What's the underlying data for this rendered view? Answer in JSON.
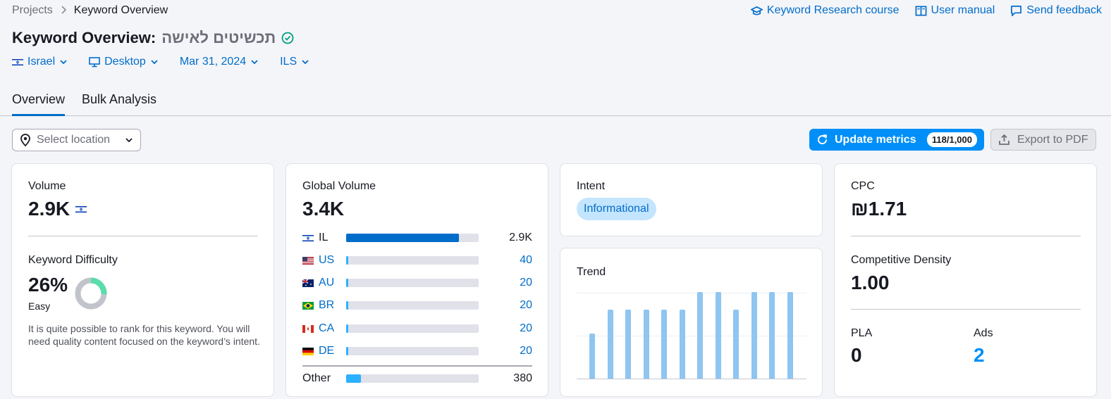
{
  "breadcrumb": {
    "root": "Projects",
    "current": "Keyword Overview"
  },
  "top_links": [
    {
      "label": "Keyword Research course",
      "icon": "graduation-cap-icon"
    },
    {
      "label": "User manual",
      "icon": "book-icon"
    },
    {
      "label": "Send feedback",
      "icon": "chat-icon"
    }
  ],
  "title": {
    "prefix": "Keyword Overview:",
    "keyword": "תכשיטים לאישה"
  },
  "filters": {
    "country": "Israel",
    "device": "Desktop",
    "date": "Mar 31, 2024",
    "currency": "ILS"
  },
  "tabs": [
    "Overview",
    "Bulk Analysis"
  ],
  "location": {
    "placeholder": "Select location"
  },
  "actions": {
    "update_label": "Update metrics",
    "update_badge": "118/1,000",
    "export_label": "Export to PDF"
  },
  "volume": {
    "label": "Volume",
    "value": "2.9K"
  },
  "kd": {
    "label": "Keyword Difficulty",
    "value": "26%",
    "level": "Easy",
    "percent": 26,
    "description": "It is quite possible to rank for this keyword. You will need quality content focused on the keyword’s intent."
  },
  "global_volume": {
    "label": "Global Volume",
    "value": "3.4K",
    "rows": [
      {
        "code": "IL",
        "value": "2.9K",
        "fraction": 0.85
      },
      {
        "code": "US",
        "value": "40",
        "fraction": 0.012
      },
      {
        "code": "AU",
        "value": "20",
        "fraction": 0.01
      },
      {
        "code": "BR",
        "value": "20",
        "fraction": 0.01
      },
      {
        "code": "CA",
        "value": "20",
        "fraction": 0.01
      },
      {
        "code": "DE",
        "value": "20",
        "fraction": 0.01
      }
    ],
    "other": {
      "label": "Other",
      "value": "380",
      "fraction": 0.11
    }
  },
  "intent": {
    "label": "Intent",
    "value": "Informational"
  },
  "trend": {
    "label": "Trend",
    "values": [
      0.52,
      0.8,
      0.8,
      0.8,
      0.8,
      0.8,
      1.0,
      1.0,
      0.8,
      1.0,
      1.0,
      1.0
    ]
  },
  "cpc": {
    "label": "CPC",
    "value": "₪1.71"
  },
  "competitive_density": {
    "label": "Competitive Density",
    "value": "1.00"
  },
  "pla": {
    "label": "PLA",
    "value": "0"
  },
  "ads": {
    "label": "Ads",
    "value": "2"
  },
  "colors": {
    "accent": "#008ff8",
    "link": "#006dca",
    "bar_il": "#006dca",
    "bar_other": "#2bb1ff",
    "trend_bar": "#8ec5f1",
    "kd_green": "#59ddaa"
  }
}
